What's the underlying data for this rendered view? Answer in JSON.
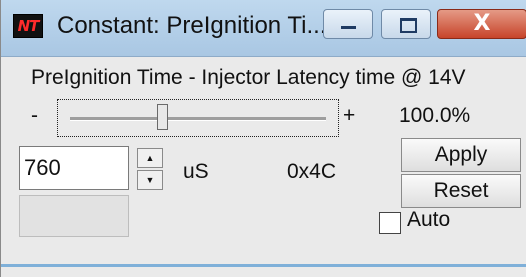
{
  "window": {
    "title": "Constant: PreIgnition Ti...",
    "app_icon_text": "NT",
    "close_glyph": "X"
  },
  "heading": "PreIgnition Time - Injector Latency time @ 14V",
  "slider": {
    "minus_label": "-",
    "plus_label": "+",
    "percent": "100.0%",
    "position_fraction": 0.36
  },
  "value": {
    "input_value": "760",
    "units": "uS",
    "hex": "0x4C",
    "spin_up": "▲",
    "spin_down": "▼"
  },
  "buttons": {
    "apply": "Apply",
    "reset": "Reset"
  },
  "auto": {
    "label": "Auto",
    "checked": false
  },
  "colors": {
    "titlebar": "#b6d0ea",
    "close_button": "#c7442a",
    "accent_line": "#7fb0d9"
  }
}
